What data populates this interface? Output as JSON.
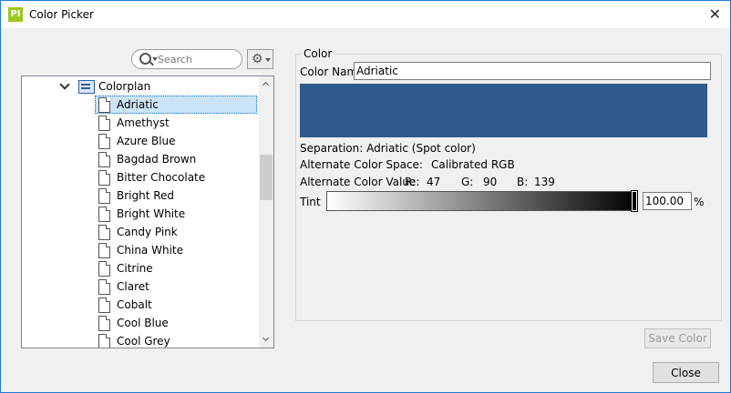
{
  "window": {
    "title": "Color Picker",
    "app_icon_text": "PI"
  },
  "search": {
    "placeholder": "Search"
  },
  "tree": {
    "group": "Colorplan",
    "items": [
      "Adriatic",
      "Amethyst",
      "Azure Blue",
      "Bagdad Brown",
      "Bitter Chocolate",
      "Bright Red",
      "Bright White",
      "Candy Pink",
      "China White",
      "Citrine",
      "Claret",
      "Cobalt",
      "Cool Blue",
      "Cool Grey"
    ],
    "selected": "Adriatic"
  },
  "color": {
    "group_title": "Color",
    "name_label": "Color Name",
    "name_value": "Adriatic",
    "swatch_hex": "#2f5a8b",
    "separation_text": "Separation: Adriatic (Spot color)",
    "alt_space_label": "Alternate Color Space:",
    "alt_space_value": "Calibrated RGB",
    "alt_value_label": "Alternate Color Value:",
    "r_label": "R:",
    "r_value": "47",
    "g_label": "G:",
    "g_value": "90",
    "b_label": "B:",
    "b_value": "139",
    "tint_label": "Tint",
    "tint_value": "100.00",
    "tint_level": 100,
    "tint_unit": "%"
  },
  "buttons": {
    "save_color": "Save Color",
    "close": "Close"
  }
}
